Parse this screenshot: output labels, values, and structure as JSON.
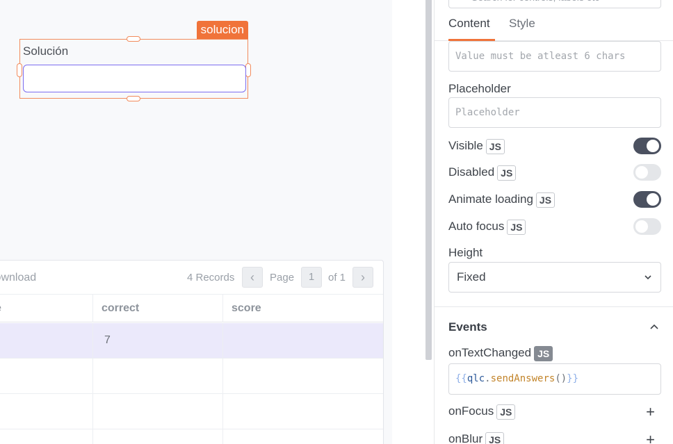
{
  "canvas": {
    "widget": {
      "tag": "solucion",
      "label": "Solución",
      "input_value": ""
    },
    "table": {
      "download_label": "Download",
      "records_label": "4 Records",
      "page_label": "Page",
      "page_number": "1",
      "page_of": "of 1",
      "prev_icon": "‹",
      "next_icon": "›",
      "columns": [
        "e",
        "correct",
        "score"
      ],
      "rows": [
        {
          "c1": "",
          "correct": "7",
          "score": ""
        },
        {
          "c1": "",
          "correct": "",
          "score": ""
        },
        {
          "c1": "",
          "correct": "",
          "score": ""
        },
        {
          "c1": "",
          "correct": "",
          "score": ""
        }
      ]
    }
  },
  "pane": {
    "search_placeholder": "Search for controls, labels etc",
    "tabs": [
      {
        "label": "Content",
        "active": true
      },
      {
        "label": "Style",
        "active": false
      }
    ],
    "error_message_value": "Value must be atleast 6 chars",
    "placeholder_label": "Placeholder",
    "placeholder_value": "Placeholder",
    "js_badge": "JS",
    "toggles": [
      {
        "label": "Visible",
        "on": true
      },
      {
        "label": "Disabled",
        "on": false
      },
      {
        "label": "Animate loading",
        "on": true
      },
      {
        "label": "Auto focus",
        "on": false
      }
    ],
    "height_label": "Height",
    "height_value": "Fixed",
    "events_title": "Events",
    "on_text_changed_label": "onTextChanged",
    "on_text_changed_code": {
      "open": "{{",
      "object": "qlc",
      "dot": ".",
      "method": "sendAnswers",
      "parens": "()",
      "close": "}}"
    },
    "on_focus_label": "onFocus",
    "on_blur_label": "onBlur",
    "plus_icon": "+"
  },
  "colors": {
    "accent": "#f0733a",
    "toggle_on": "#4b5160",
    "selection_row": "#ebe9fb",
    "input_focus": "#7b6cf0"
  }
}
